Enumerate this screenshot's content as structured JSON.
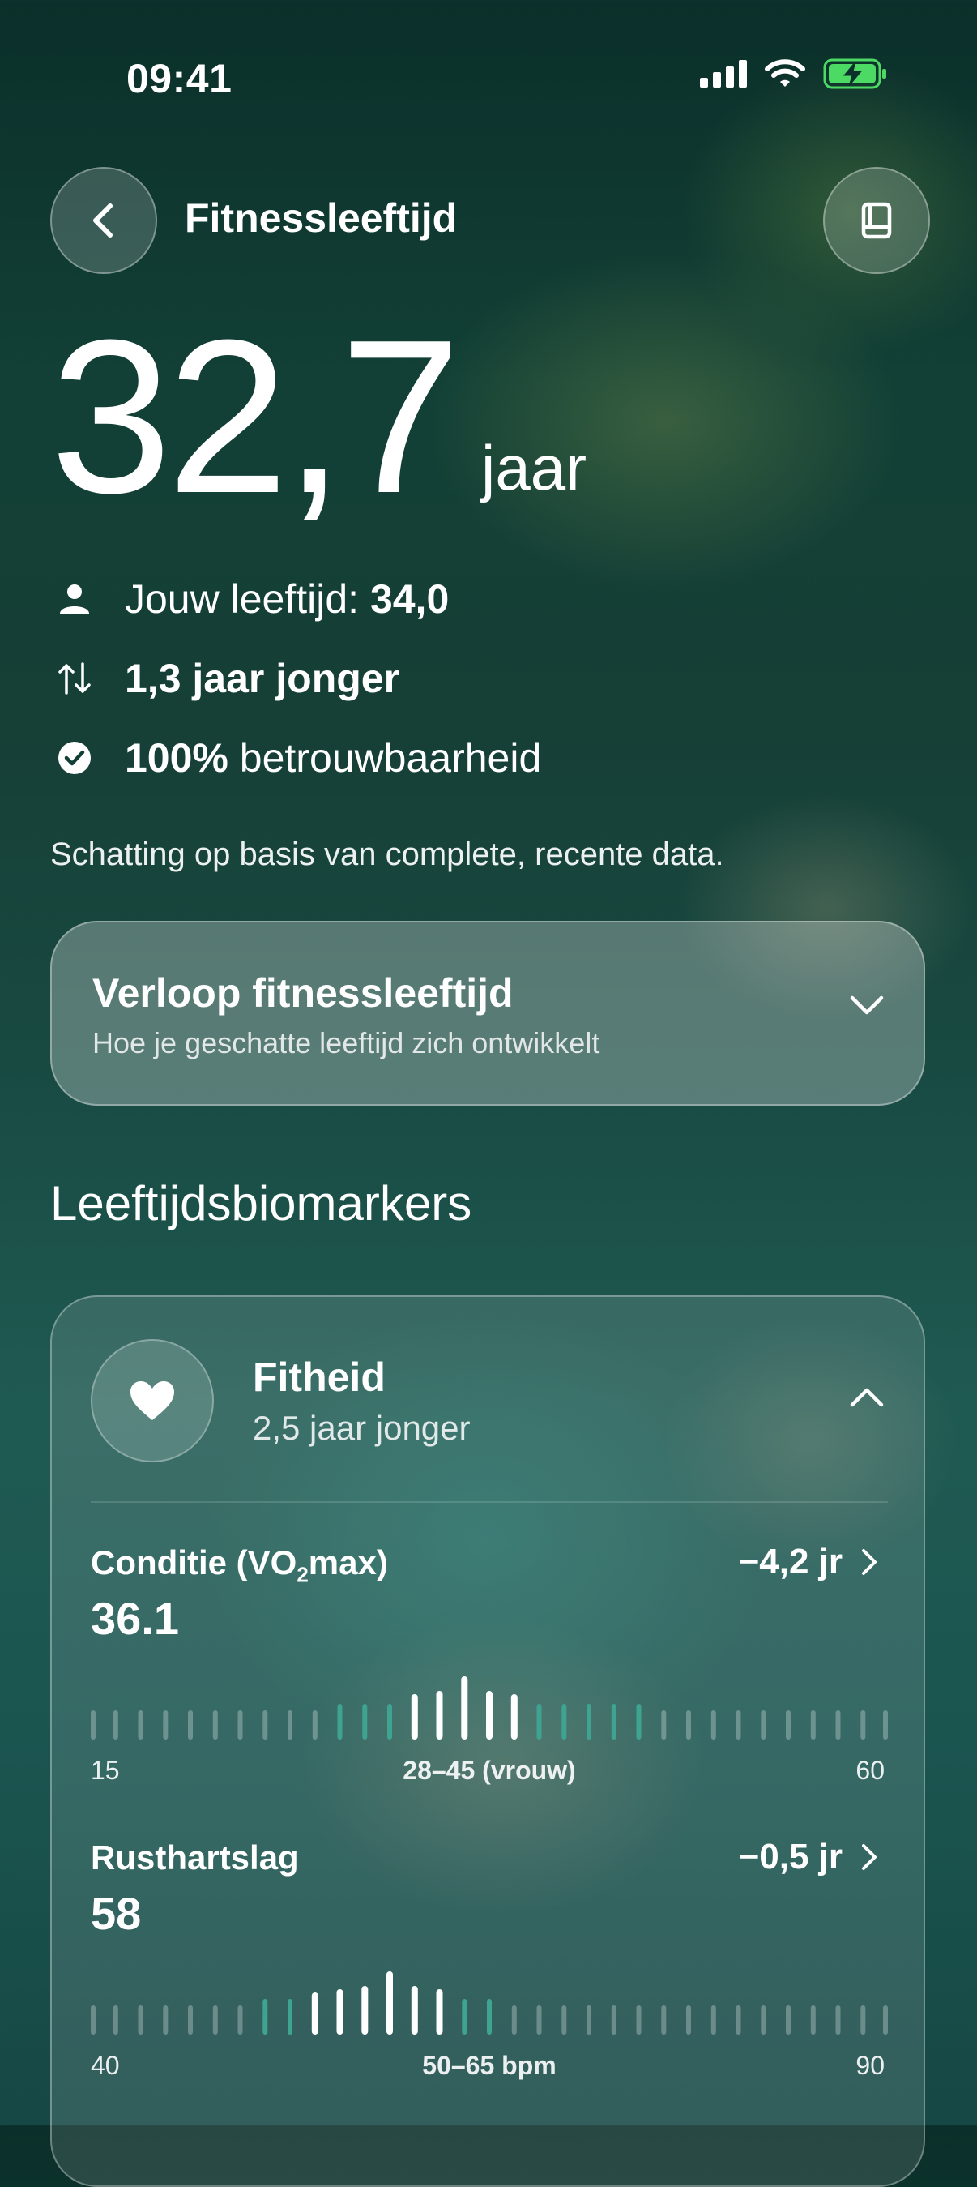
{
  "status_bar": {
    "time": "09:41"
  },
  "header": {
    "title": "Fitnessleeftijd"
  },
  "hero": {
    "value": "32,7",
    "unit": "jaar"
  },
  "stats": {
    "age_label": "Jouw leeftijd: ",
    "age_value": "34,0",
    "difference": "1,3 jaar jonger",
    "reliability_value": "100%",
    "reliability_label": " betrouwbaarheid"
  },
  "estimate_note": "Schatting op basis van complete, recente data.",
  "trend_card": {
    "title": "Verloop fitnessleeftijd",
    "subtitle": "Hoe je geschatte leeftijd zich ontwikkelt"
  },
  "section_title": "Leeftijdsbiomarkers",
  "fitness_group": {
    "title": "Fitheid",
    "subtitle": "2,5 jaar jonger",
    "markers": [
      {
        "name_prefix": "Conditie (VO",
        "name_sub": "2",
        "name_suffix": "max)",
        "value": "36.1",
        "delta": "−4,2 jr",
        "scale_min": "15",
        "scale_range": "28–45 (vrouw)",
        "scale_max": "60"
      },
      {
        "name": "Rusthartslag",
        "value": "58",
        "delta": "−0,5 jr",
        "scale_min": "40",
        "scale_range": "50–65 bpm",
        "scale_max": "90"
      }
    ]
  },
  "colors": {
    "accent_teal": "#3fa391",
    "tick_dim": "rgba(255,255,255,0.28)",
    "tick_bright": "#ffffff"
  }
}
